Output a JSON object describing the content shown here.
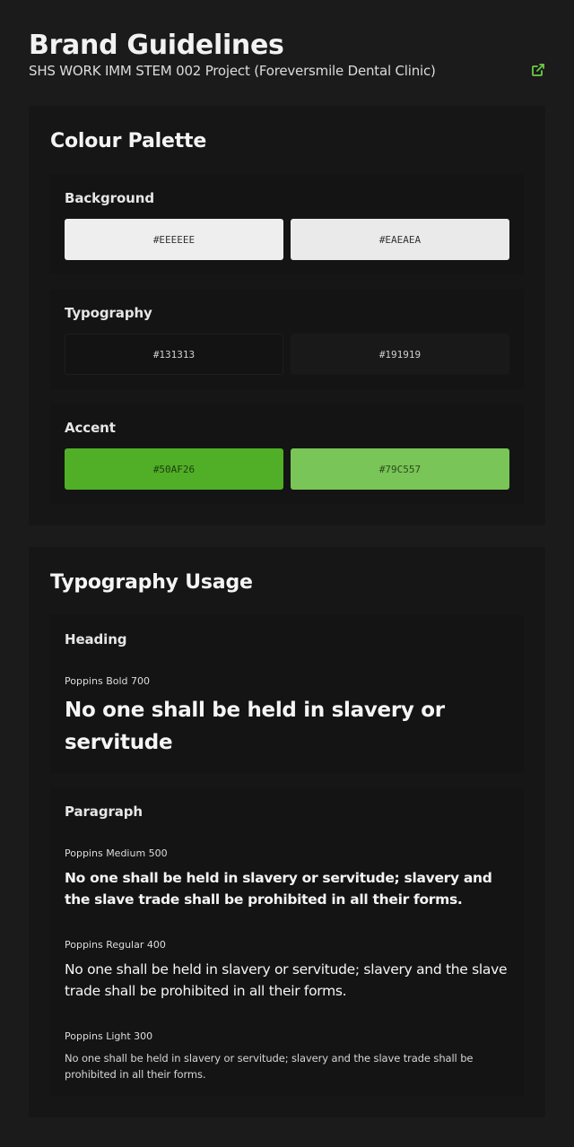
{
  "header": {
    "title": "Brand Guidelines",
    "subtitle": "SHS WORK IMM STEM 002 Project (Foreversmile Dental Clinic)",
    "external_link_icon": "external-link-icon"
  },
  "palette": {
    "title": "Colour Palette",
    "groups": [
      {
        "label": "Background",
        "swatches": [
          "#EEEEEE",
          "#EAEAEA"
        ]
      },
      {
        "label": "Typography",
        "swatches": [
          "#131313",
          "#191919"
        ]
      },
      {
        "label": "Accent",
        "swatches": [
          "#50AF26",
          "#79C557"
        ]
      }
    ]
  },
  "typography": {
    "title": "Typography Usage",
    "heading": {
      "label": "Heading",
      "font": "Poppins Bold 700",
      "sample": "No one shall be held in slavery or servitude"
    },
    "paragraph": {
      "label": "Paragraph",
      "samples": [
        {
          "font": "Poppins Medium 500",
          "text": "No one shall be held in slavery or servitude; slavery and the slave trade shall be prohibited in all their forms."
        },
        {
          "font": "Poppins Regular 400",
          "text": "No one shall be held in slavery or servitude; slavery and the slave trade shall be prohibited in all their forms."
        },
        {
          "font": "Poppins Light 300",
          "text": "No one shall be held in slavery or servitude; slavery and the slave trade shall be prohibited in all their forms."
        }
      ]
    }
  },
  "colors": {
    "accent": "#50AF26",
    "link_icon": "#6fcb45"
  }
}
